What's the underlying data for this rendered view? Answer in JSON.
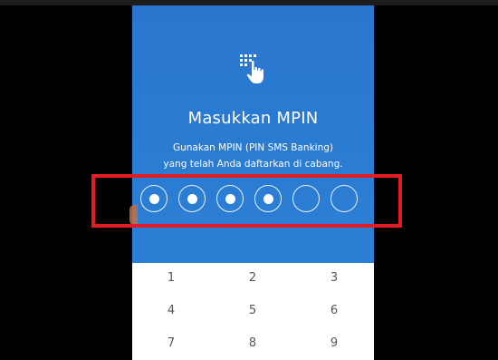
{
  "screen": {
    "title": "Masukkan MPIN",
    "subtitle_line1": "Gunakan MPIN (PIN SMS Banking)",
    "subtitle_line2": "yang telah Anda daftarkan di cabang.",
    "icon": "touch-keypad-icon"
  },
  "pin": {
    "length": 6,
    "filled": 4
  },
  "keypad": {
    "keys": [
      "1",
      "2",
      "3",
      "4",
      "5",
      "6",
      "7",
      "8",
      "9"
    ]
  },
  "colors": {
    "header_blue": "#2a7dd1",
    "highlight_red": "#e31b23",
    "keypad_bg": "#ffffff"
  }
}
